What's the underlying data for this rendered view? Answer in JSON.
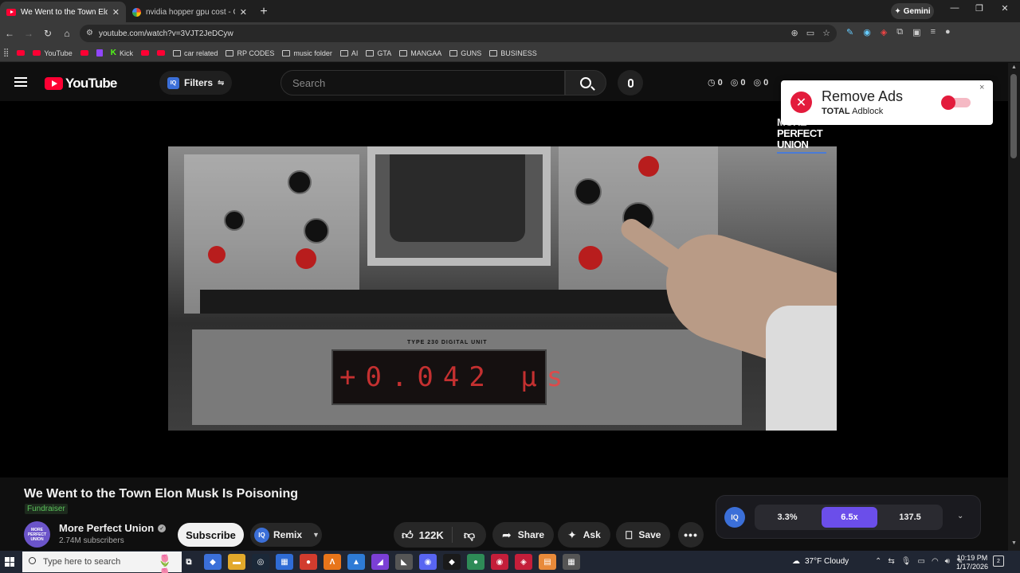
{
  "browser": {
    "tabs": [
      {
        "title": "We Went to the Town Elon Mus",
        "active": true
      },
      {
        "title": "nvidia hopper gpu cost - Goog",
        "active": false
      }
    ],
    "gemini_label": "Gemini",
    "url": "youtube.com/watch?v=3VJT2JeDCyw",
    "bookmarks": [
      "YouTube",
      "Kick",
      "car related",
      "RP CODES",
      "music folder",
      "AI",
      "GTA",
      "MANGAA",
      "GUNS",
      "BUSINESS"
    ]
  },
  "youtube": {
    "logo_text": "YouTube",
    "filters_label": "Filters",
    "iq_label": "IQ",
    "search_placeholder": "Search",
    "counters": [
      "0",
      "0",
      "0"
    ]
  },
  "adblock": {
    "title": "Remove Ads",
    "brand_bold": "TOTAL",
    "brand_rest": "Adblock",
    "close": "×",
    "enabled": false
  },
  "video": {
    "watermark_lines": [
      "MORE",
      "PERFECT",
      "UNION"
    ],
    "frame_label": "TYPE 230 DIGITAL UNIT",
    "frame_digits": "+0.042 μs",
    "title": "We Went to the Town Elon Musk Is Poisoning",
    "badge": "Fundraiser",
    "avatar_text": "MORE PERFECT UNION",
    "channel_name": "More Perfect Union",
    "subscribers": "2.74M subscribers",
    "subscribe_label": "Subscribe",
    "remix_label": "Remix",
    "like_count": "122K",
    "share_label": "Share",
    "ask_label": "Ask",
    "save_label": "Save"
  },
  "speed_panel": {
    "iq_label": "IQ",
    "values": [
      "3.3%",
      "6.5x",
      "137.5"
    ],
    "selected_index": 1,
    "accent": "#6b4eea"
  },
  "taskbar": {
    "search_placeholder": "Type here to search",
    "weather": "37°F  Cloudy",
    "time": "10:19 PM",
    "date": "1/17/2026",
    "notif_count": "2"
  }
}
